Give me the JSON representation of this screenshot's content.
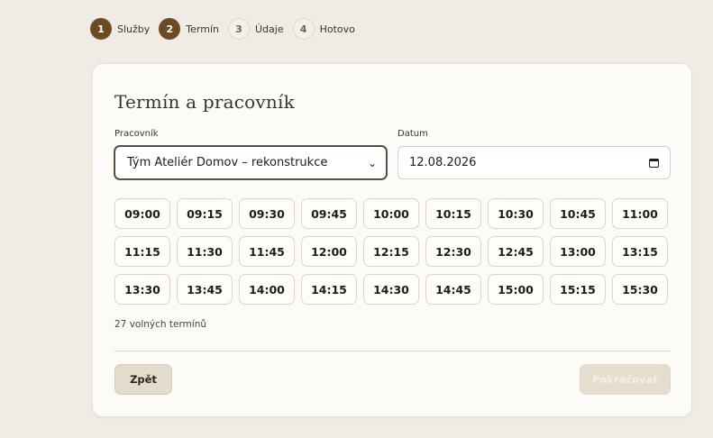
{
  "stepper": {
    "steps": [
      {
        "num": "1",
        "label": "Služby",
        "state": "done"
      },
      {
        "num": "2",
        "label": "Termín",
        "state": "active"
      },
      {
        "num": "3",
        "label": "Údaje",
        "state": "pending"
      },
      {
        "num": "4",
        "label": "Hotovo",
        "state": "pending"
      }
    ]
  },
  "card": {
    "title": "Termín a pracovník",
    "worker": {
      "label": "Pracovník",
      "value": "Tým Ateliér Domov – rekonstrukce"
    },
    "date": {
      "label": "Datum",
      "value": "12.08.2026"
    },
    "slots": [
      "09:00",
      "09:15",
      "09:30",
      "09:45",
      "10:00",
      "10:15",
      "10:30",
      "10:45",
      "11:00",
      "11:15",
      "11:30",
      "11:45",
      "12:00",
      "12:15",
      "12:30",
      "12:45",
      "13:00",
      "13:15",
      "13:30",
      "13:45",
      "14:00",
      "14:15",
      "14:30",
      "14:45",
      "15:00",
      "15:15",
      "15:30"
    ],
    "count_text": "27 volných termínů",
    "back_label": "Zpět",
    "next_label": "Pokračovat"
  },
  "colors": {
    "accent": "#6b4a26",
    "page_bg": "#f0ebe4",
    "card_bg": "#fdfbf7"
  }
}
